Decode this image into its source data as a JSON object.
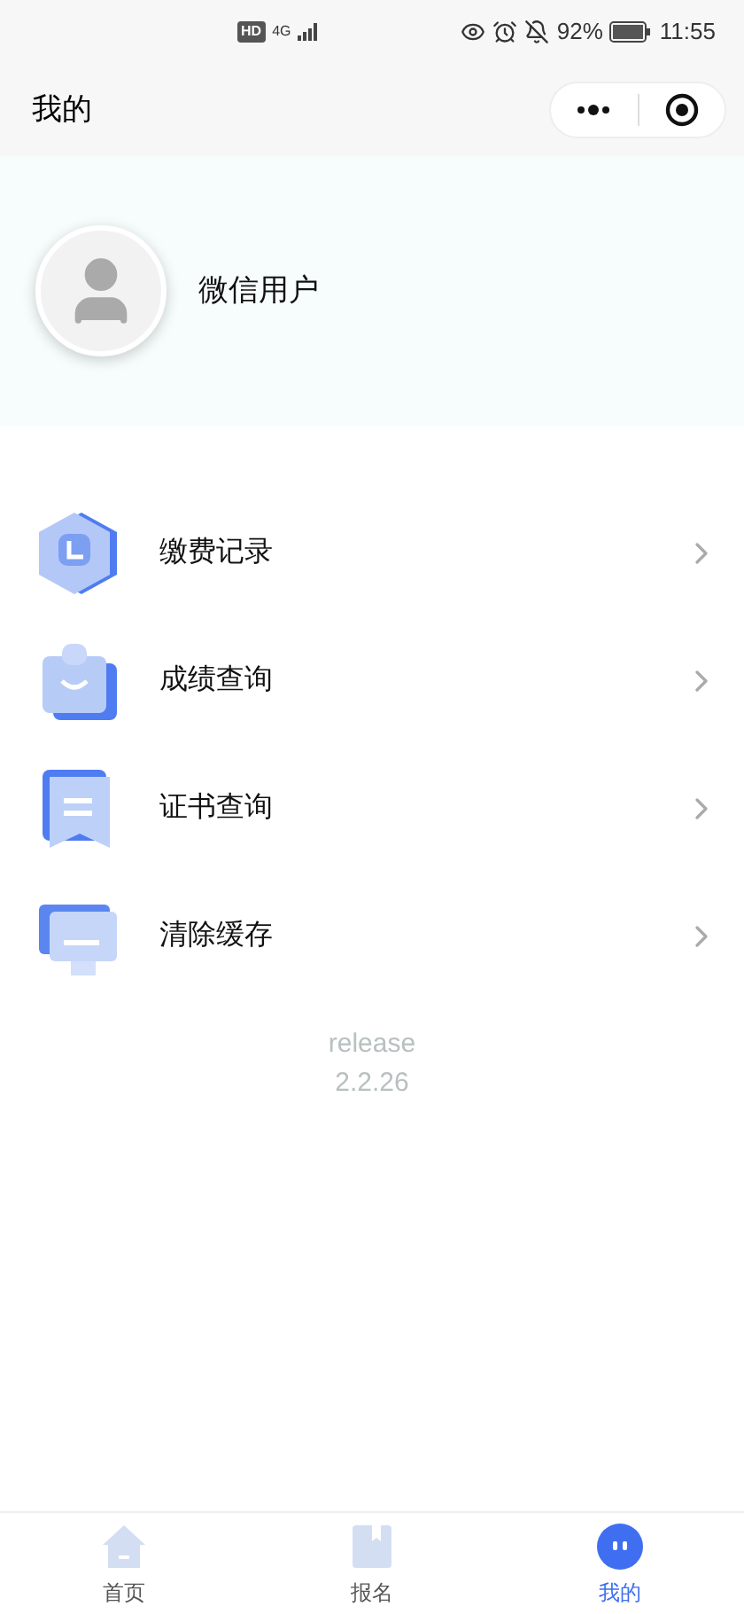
{
  "status_bar": {
    "network_badge": "HD",
    "network_type": "4G",
    "battery": "92%",
    "time": "11:55"
  },
  "header": {
    "title": "我的"
  },
  "profile": {
    "name": "微信用户"
  },
  "menu": [
    {
      "kind": "clock",
      "label": "缴费记录"
    },
    {
      "kind": "bag",
      "label": "成绩查询"
    },
    {
      "kind": "certificate",
      "label": "证书查询"
    },
    {
      "kind": "monitor",
      "label": "清除缓存"
    }
  ],
  "version": {
    "channel": "release",
    "number": "2.2.26"
  },
  "tabs": [
    {
      "kind": "home",
      "label": "首页",
      "selected": false
    },
    {
      "kind": "bookmark",
      "label": "报名",
      "selected": false
    },
    {
      "kind": "face",
      "label": "我的",
      "selected": true
    }
  ]
}
